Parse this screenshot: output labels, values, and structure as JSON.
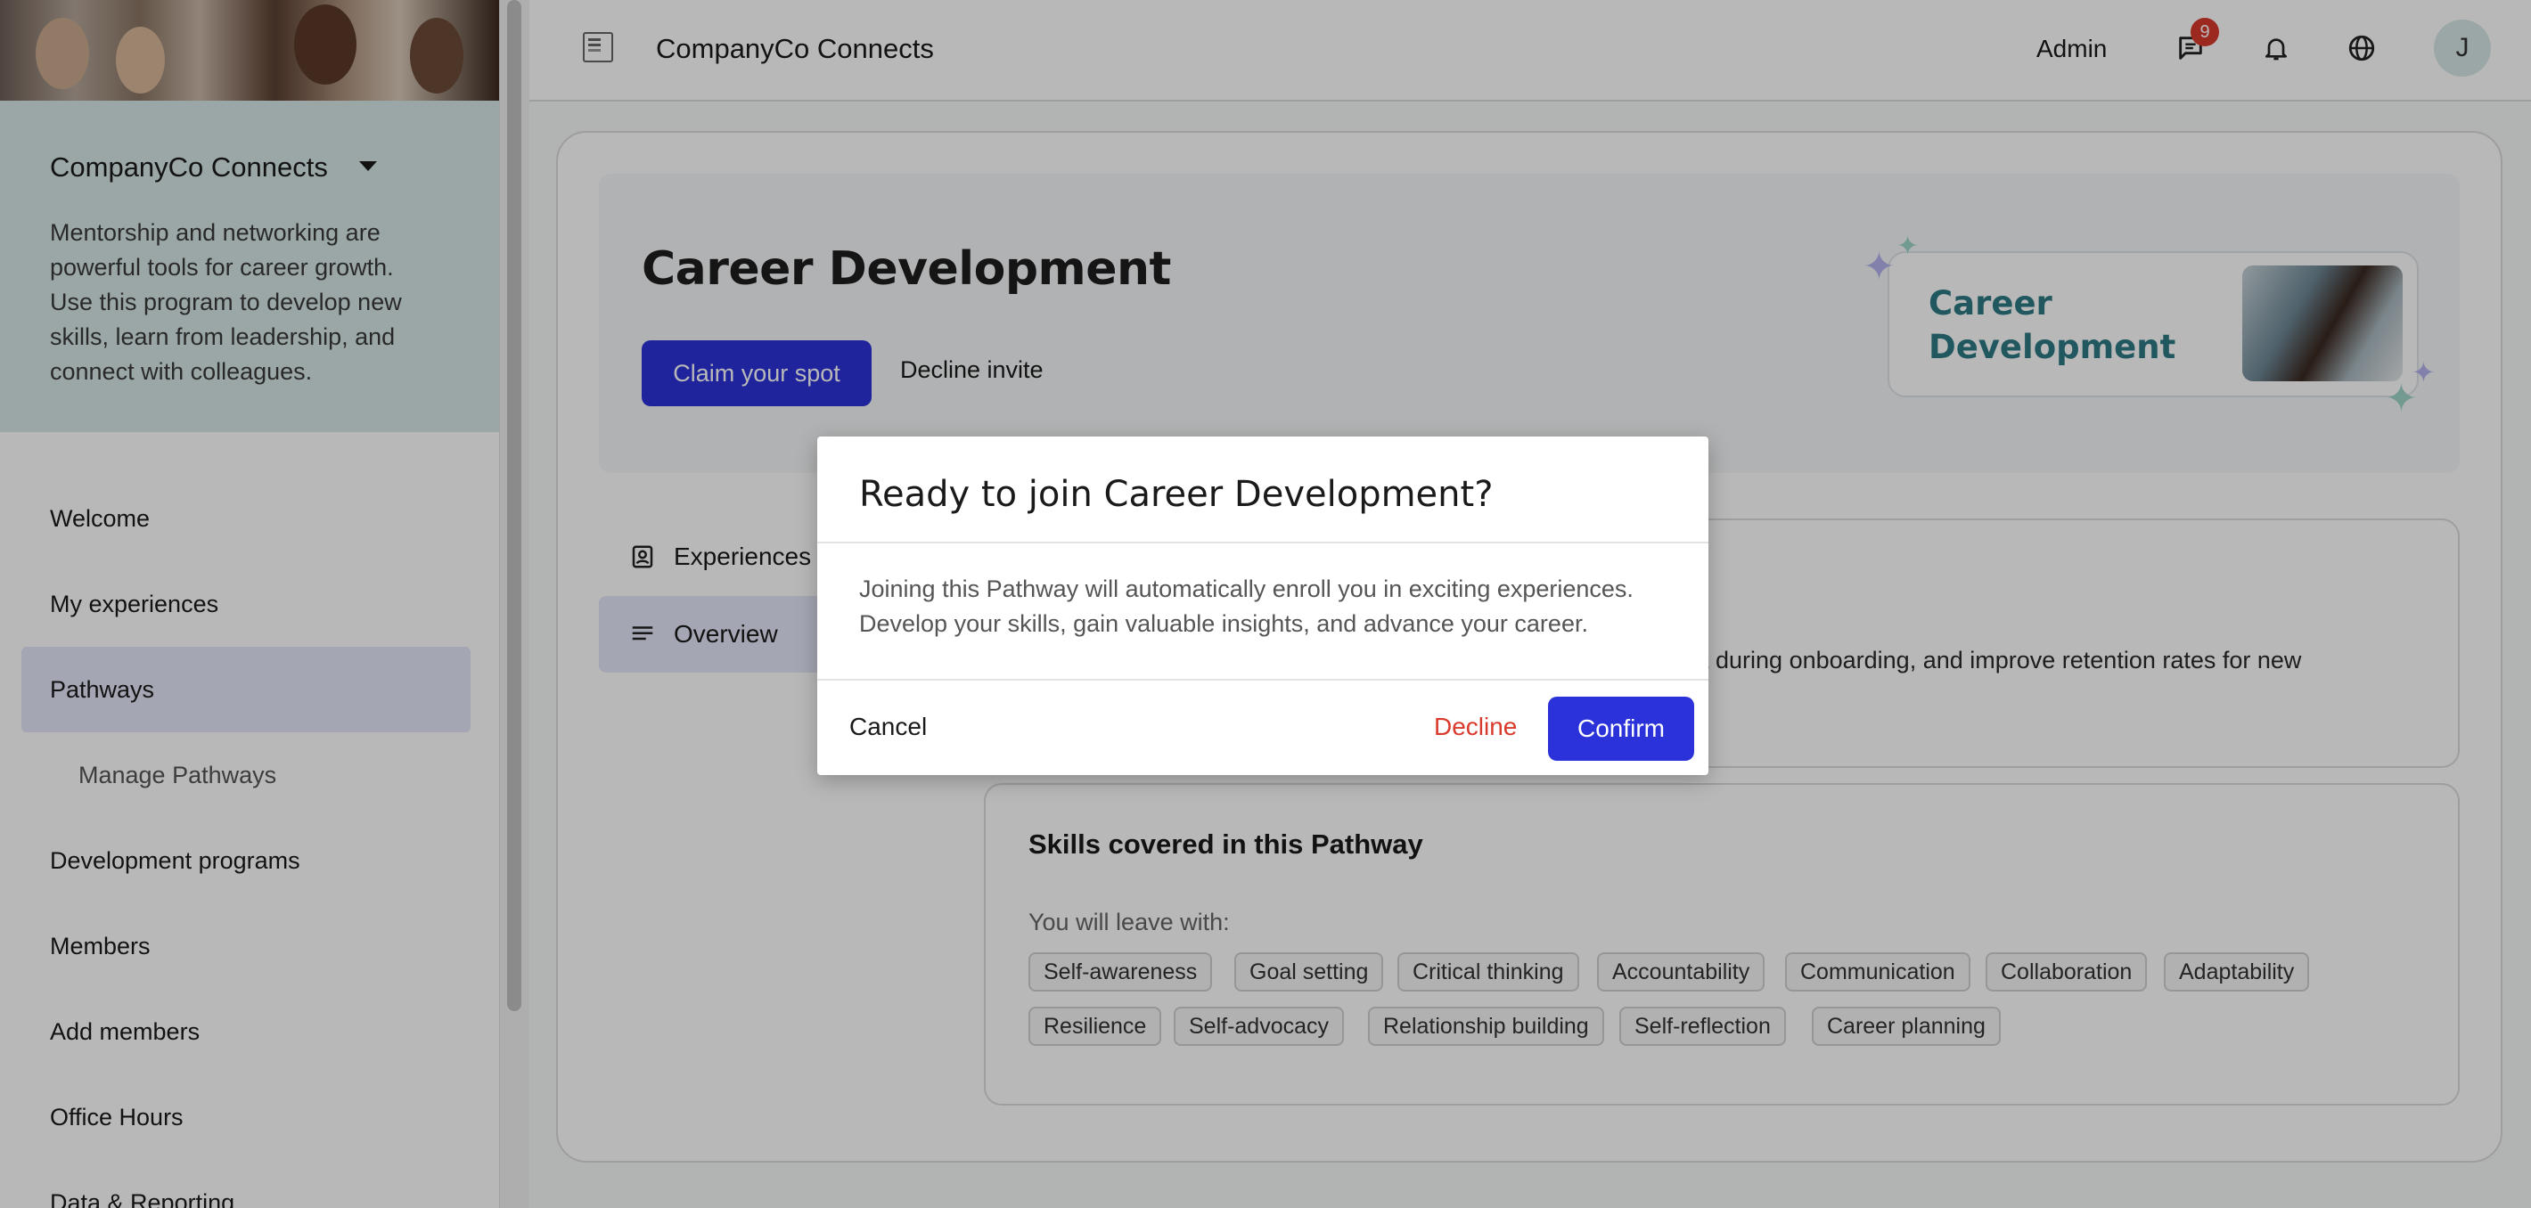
{
  "app": {
    "title": "CompanyCo Connects"
  },
  "header": {
    "admin_label": "Admin",
    "messages_badge": "9",
    "avatar_initial": "J"
  },
  "sidebar": {
    "org_name": "CompanyCo Connects",
    "description": "Mentorship and networking are powerful tools for career growth. Use this program to develop new skills, learn from leadership, and connect with colleagues.",
    "items": [
      {
        "label": "Welcome"
      },
      {
        "label": "My experiences"
      },
      {
        "label": "Pathways"
      },
      {
        "label": "Manage Pathways"
      },
      {
        "label": "Development programs"
      },
      {
        "label": "Members"
      },
      {
        "label": "Add members"
      },
      {
        "label": "Office Hours"
      },
      {
        "label": "Data & Reporting"
      }
    ],
    "active_item": "Pathways"
  },
  "hero": {
    "title": "Career Development",
    "claim_button": "Claim your spot",
    "decline_link": "Decline invite",
    "promo_text": "Career Development"
  },
  "tabs": [
    {
      "label": "Experiences"
    },
    {
      "label": "Overview"
    }
  ],
  "active_tab": "Overview",
  "about": {
    "visible_text": "nt during onboarding, and improve retention rates for new"
  },
  "skills": {
    "title": "Skills covered in this Pathway",
    "subtitle": "You will leave with:",
    "chips": [
      "Self-awareness",
      "Goal setting",
      "Critical thinking",
      "Accountability",
      "Communication",
      "Collaboration",
      "Adaptability",
      "Resilience",
      "Self-advocacy",
      "Relationship building",
      "Self-reflection",
      "Career planning"
    ]
  },
  "modal": {
    "title": "Ready to join Career Development?",
    "body": "Joining this Pathway will automatically enroll you in exciting experiences. Develop your skills, gain valuable insights, and advance your career.",
    "cancel": "Cancel",
    "decline": "Decline",
    "confirm": "Confirm"
  },
  "colors": {
    "primary": "#2b32d9",
    "danger": "#d93a2b",
    "accent_teal": "#2f7b86",
    "sidebar_card": "#d6e8e6",
    "active_nav": "#e4e7f8"
  },
  "icons": [
    "app-logo-icon",
    "messages-icon",
    "bell-icon",
    "globe-icon",
    "caret-down-icon",
    "experiences-icon",
    "overview-icon",
    "sparkle-icon"
  ]
}
